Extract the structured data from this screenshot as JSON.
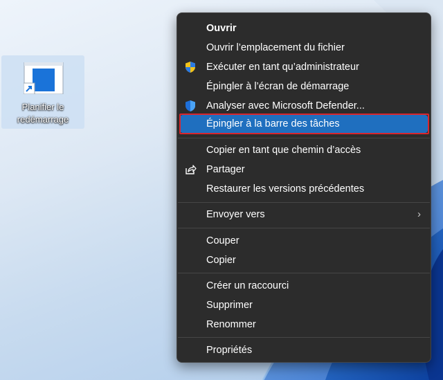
{
  "desktop": {
    "shortcut_label": "Planifier le redémarrage",
    "shortcut_icon": "shortcut-file-icon"
  },
  "context_menu": {
    "items": [
      {
        "label": "Ouvrir",
        "bold": true
      },
      {
        "label": "Ouvrir l’emplacement du fichier"
      },
      {
        "label": "Exécuter en tant qu’administrateur",
        "icon": "uac-shield-icon"
      },
      {
        "label": "Épingler à l’écran de démarrage"
      },
      {
        "label": "Analyser avec Microsoft Defender...",
        "icon": "defender-shield-icon"
      },
      {
        "label": "Épingler à la barre des tâches",
        "highlighted": true
      },
      {
        "label": "Copier en tant que chemin d’accès"
      },
      {
        "label": "Partager",
        "icon": "share-icon"
      },
      {
        "label": "Restaurer les versions précédentes"
      },
      {
        "label": "Envoyer vers",
        "submenu": true
      },
      {
        "label": "Couper"
      },
      {
        "label": "Copier"
      },
      {
        "label": "Créer un raccourci"
      },
      {
        "label": "Supprimer"
      },
      {
        "label": "Renommer"
      },
      {
        "label": "Propriétés"
      }
    ],
    "highlight_color": "#1f6fbf",
    "annotation_color": "#d9262d"
  }
}
